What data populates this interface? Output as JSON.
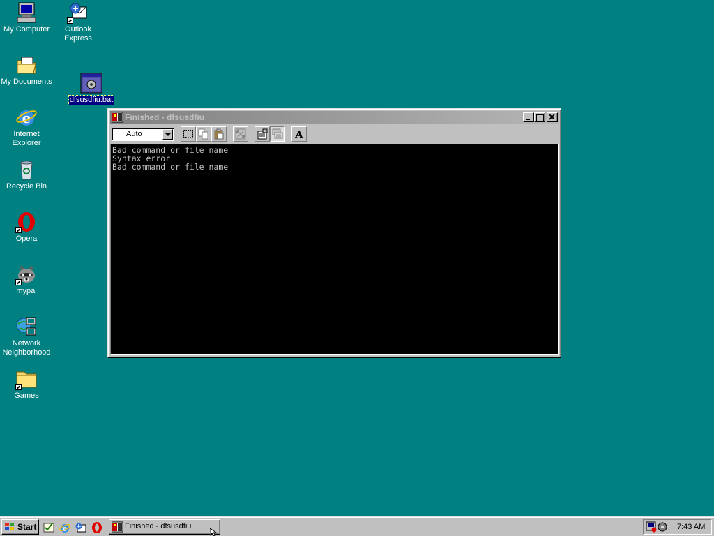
{
  "desktop": {
    "icons": [
      {
        "label": "My Computer",
        "icon": "my-computer-icon"
      },
      {
        "label": "Outlook Express",
        "icon": "outlook-express-icon"
      },
      {
        "label": "My Documents",
        "icon": "my-documents-icon"
      },
      {
        "label": "dfsusdfiu.bat",
        "icon": "batch-file-icon",
        "selected": true
      },
      {
        "label": "Internet Explorer",
        "icon": "internet-explorer-icon"
      },
      {
        "label": "Recycle Bin",
        "icon": "recycle-bin-icon"
      },
      {
        "label": "Opera",
        "icon": "opera-icon"
      },
      {
        "label": "mypal",
        "icon": "mypal-icon"
      },
      {
        "label": "Network Neighborhood",
        "icon": "network-neighborhood-icon"
      },
      {
        "label": "Games",
        "icon": "folder-icon"
      }
    ],
    "background_color": "#008080"
  },
  "window": {
    "title": "Finished - dfsusdfiu",
    "font_select_value": "Auto",
    "toolbar_tools": [
      "mark-icon",
      "copy-icon",
      "paste-icon",
      "full-screen-icon",
      "properties-icon",
      "background-icon",
      "font-icon"
    ],
    "console_lines": [
      "Bad command or file name",
      "Syntax error",
      "Bad command or file name"
    ],
    "colors": {
      "title_inactive_start": "#808080",
      "title_inactive_end": "#b5b5b5",
      "console_bg": "#000000",
      "console_fg": "#c0c0c0"
    }
  },
  "taskbar": {
    "start_label": "Start",
    "quick_launch": [
      "show-desktop-icon",
      "internet-explorer-icon",
      "outlook-express-icon",
      "opera-icon"
    ],
    "task_label": "Finished - dfsusdfiu",
    "clock": "7:43 AM"
  }
}
